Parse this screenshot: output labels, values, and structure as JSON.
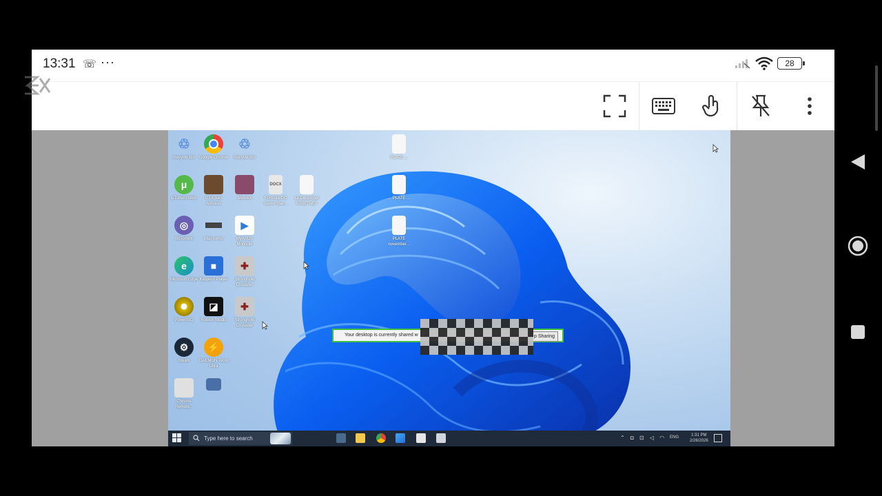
{
  "status_bar": {
    "time": "13:31",
    "battery": "28"
  },
  "desktop": {
    "icons": [
      {
        "label": "Recycle Bin",
        "bg": "#6a8fc4",
        "glyph": "♲"
      },
      {
        "label": "Google Chrome",
        "bg": "#e94235",
        "glyph": "●"
      },
      {
        "label": "Recycle Bin",
        "bg": "#6a8fc4",
        "glyph": "♲"
      },
      {
        "label": "μTorrent Web",
        "bg": "#54b948",
        "glyph": "μ"
      },
      {
        "label": "GTA San Andreas",
        "bg": "#6b4a2e",
        "glyph": ""
      },
      {
        "label": "Mewtex",
        "bg": "#8a4b6a",
        "glyph": ""
      },
      {
        "label": "Formula GC basen (bar...",
        "bg": "#e6e6e6",
        "glyph": ""
      },
      {
        "label": "12-December ASSETNET",
        "bg": "#f5f5f5",
        "glyph": ""
      },
      {
        "label": "BitTorrent",
        "bg": "#6b5fb3",
        "glyph": "◎"
      },
      {
        "label": "Intel mirror",
        "bg": "#444",
        "glyph": ""
      },
      {
        "label": "MyASUS Monodle",
        "bg": "#2f7dd6",
        "glyph": "▶"
      },
      {
        "label": "Microsoft Edge",
        "bg": "#1c8fc8",
        "glyph": "e"
      },
      {
        "label": "Kaspero Player",
        "bg": "#2a6ed8",
        "glyph": "■"
      },
      {
        "label": "Stronghold Crusader",
        "bg": "#8a1f1f",
        "glyph": "✚"
      },
      {
        "label": "PowerISO",
        "bg": "#d6b400",
        "glyph": "◉"
      },
      {
        "label": "Roblox Studio",
        "bg": "#111",
        "glyph": "◪"
      },
      {
        "label": "Stronghold Crusader",
        "bg": "#8a1f1f",
        "glyph": "✚"
      },
      {
        "label": "Steam",
        "bg": "#1b2838",
        "glyph": "⚙"
      },
      {
        "label": "DAEMON Tools Ultra",
        "bg": "#f2a20c",
        "glyph": "⚡"
      },
      {
        "label": "Chrome Remote...",
        "bg": "#e0e0e0",
        "glyph": ""
      },
      {
        "label": "",
        "bg": "#4a6ea8",
        "glyph": ""
      },
      {
        "label": "PLATE ...",
        "bg": "#f5f5f5",
        "glyph": ""
      },
      {
        "label": "... PLATE ...",
        "bg": "#f5f5f5",
        "glyph": ""
      },
      {
        "label": "PLATE november...",
        "bg": "#f5f5f5",
        "glyph": ""
      }
    ],
    "share_banner": {
      "text": "Your desktop is currently shared w",
      "button": "p Sharing"
    },
    "taskbar": {
      "search_placeholder": "Type here to search",
      "lang": "ENG",
      "time": "1:31 PM",
      "date": "2/26/2026"
    }
  }
}
